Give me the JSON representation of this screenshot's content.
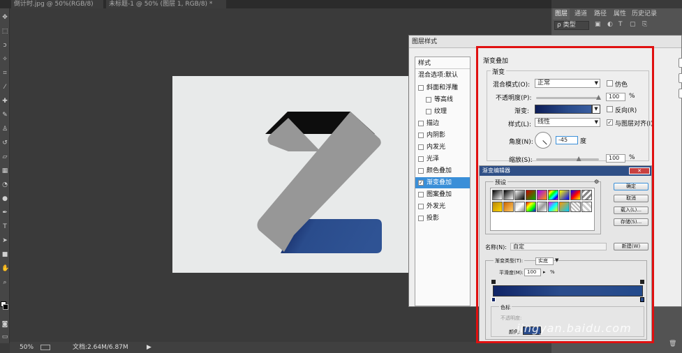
{
  "tabs": [
    {
      "label": "倒计时.jpg @ 50%(RGB/8)"
    },
    {
      "label": "未标题-1 @ 50% (图层 1, RGB/8) *"
    }
  ],
  "status": {
    "zoom": "50%",
    "doc": "文档:2.64M/6.87M"
  },
  "panels": {
    "tabs": [
      "图层",
      "通道",
      "路径",
      "属性",
      "历史记录"
    ],
    "kind_label": "ρ 类型"
  },
  "dialog": {
    "title": "图层样式",
    "style_header": "样式",
    "blend_default": "混合选项:默认",
    "styles": [
      {
        "label": "斜面和浮雕",
        "checked": false,
        "indent": false
      },
      {
        "label": "等高线",
        "checked": false,
        "indent": true
      },
      {
        "label": "纹理",
        "checked": false,
        "indent": true
      },
      {
        "label": "描边",
        "checked": false,
        "indent": false
      },
      {
        "label": "内阴影",
        "checked": false,
        "indent": false
      },
      {
        "label": "内发光",
        "checked": false,
        "indent": false
      },
      {
        "label": "光泽",
        "checked": false,
        "indent": false
      },
      {
        "label": "颜色叠加",
        "checked": false,
        "indent": false
      },
      {
        "label": "渐变叠加",
        "checked": true,
        "indent": false,
        "selected": true
      },
      {
        "label": "图案叠加",
        "checked": false,
        "indent": false
      },
      {
        "label": "外发光",
        "checked": false,
        "indent": false
      },
      {
        "label": "投影",
        "checked": false,
        "indent": false
      }
    ],
    "overlay": {
      "section_title": "渐变叠加",
      "group_title": "渐变",
      "blend_mode_label": "混合模式(O):",
      "blend_mode_value": "正常",
      "dither_label": "仿色",
      "opacity_label": "不透明度(P):",
      "opacity_value": "100",
      "opacity_unit": "%",
      "opacity_level": 1.0,
      "gradient_label": "渐变:",
      "reverse_label": "反向(R)",
      "style_label": "样式(L):",
      "style_value": "线性",
      "align_label": "与图层对齐(I)",
      "angle_label": "角度(N):",
      "angle_value": "-45",
      "angle_unit": "度",
      "scale_label": "缩放(S):",
      "scale_value": "100",
      "scale_unit": "%",
      "scale_level": 0.67
    }
  },
  "gradient_editor": {
    "title": "渐变编辑器",
    "presets_label": "预设",
    "ok": "确定",
    "cancel": "取消",
    "load": "载入(L)...",
    "save": "存储(S)...",
    "name_label": "名称(N):",
    "name_value": "自定",
    "new_button": "新建(W)",
    "type_label": "渐变类型(T):",
    "type_value": "实底",
    "smooth_label": "平滑度(M):",
    "smooth_value": "100",
    "smooth_unit": "%",
    "stops_label": "色标",
    "opacity_field_label": "不透明度:",
    "color_label": "颜色:"
  },
  "colors": {
    "accent_blue": "#2a4c8c",
    "dark_navy": "#0e1e58",
    "highlight_red": "#e01010",
    "selection_blue": "#3a8fd8",
    "logo_gray": "#979797",
    "logo_black": "#0d0d0d"
  },
  "watermark": "jingyan.baidu.com"
}
